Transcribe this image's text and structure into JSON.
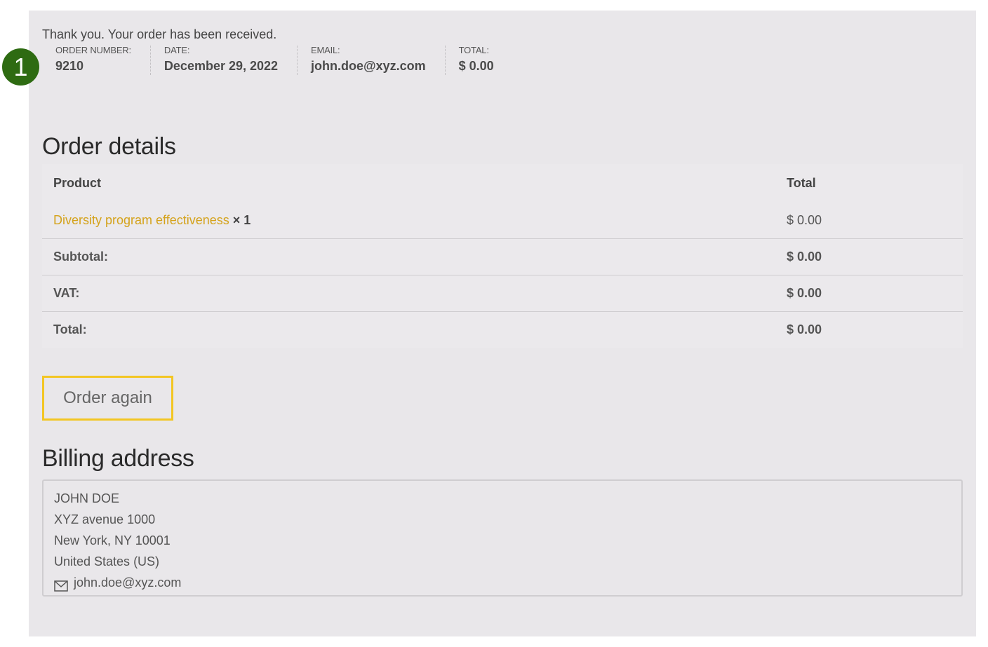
{
  "badge": {
    "number": "1",
    "color": "#2e6b12"
  },
  "thanks_message": "Thank you. Your order has been received.",
  "overview": [
    {
      "label": "ORDER NUMBER:",
      "value": "9210"
    },
    {
      "label": "DATE:",
      "value": "December 29, 2022"
    },
    {
      "label": "EMAIL:",
      "value": "john.doe@xyz.com"
    },
    {
      "label": "TOTAL:",
      "value": "$ 0.00"
    }
  ],
  "order_details": {
    "title": "Order details",
    "headers": {
      "product": "Product",
      "total": "Total"
    },
    "item": {
      "name": "Diversity program effectiveness",
      "qty": "× 1",
      "total": "$ 0.00"
    },
    "rows": [
      {
        "label": "Subtotal:",
        "value": "$ 0.00"
      },
      {
        "label": "VAT:",
        "value": "$ 0.00"
      },
      {
        "label": "Total:",
        "value": "$ 0.00"
      }
    ],
    "link_color": "#d4a21a"
  },
  "order_again_label": "Order again",
  "billing": {
    "title": "Billing address",
    "lines": [
      "JOHN DOE",
      "XYZ avenue 1000",
      "New York, NY 10001",
      "United States (US)"
    ],
    "email": "john.doe@xyz.com",
    "email_icon": "mail-icon"
  },
  "colors": {
    "accent_border": "#f3c623",
    "panel_bg": "#e9e7ea"
  }
}
